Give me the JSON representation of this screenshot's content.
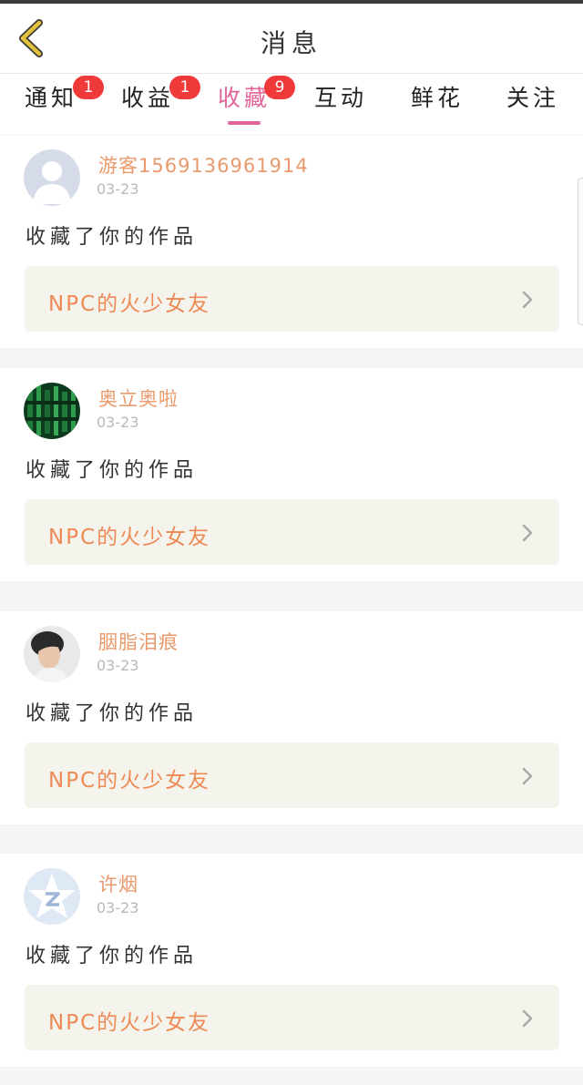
{
  "header": {
    "title": "消息",
    "back_icon": "chevron-left-icon",
    "back_color": "#e2c13b"
  },
  "tabs": [
    {
      "label": "通知",
      "badge": "1",
      "active": false
    },
    {
      "label": "收益",
      "badge": "1",
      "active": false
    },
    {
      "label": "收藏",
      "badge": "9",
      "active": true
    },
    {
      "label": "互动",
      "badge": null,
      "active": false
    },
    {
      "label": "鲜花",
      "badge": null,
      "active": false
    },
    {
      "label": "关注",
      "badge": null,
      "active": false
    }
  ],
  "messages": [
    {
      "username": "游客1569136961914",
      "date": "03-23",
      "text": "收藏了你的作品",
      "work_title": "NPC的火少女友",
      "avatar": "default-user-avatar"
    },
    {
      "username": "奥立奥啦",
      "date": "03-23",
      "text": "收藏了你的作品",
      "work_title": "NPC的火少女友",
      "avatar": "green-pattern-avatar"
    },
    {
      "username": "胭脂泪痕",
      "date": "03-23",
      "text": "收藏了你的作品",
      "work_title": "NPC的火少女友",
      "avatar": "portrait-avatar"
    },
    {
      "username": "许烟",
      "date": "03-23",
      "text": "收藏了你的作品",
      "work_title": "NPC的火少女友",
      "avatar": "qzone-star-avatar"
    }
  ],
  "colors": {
    "accent_pink": "#e0649a",
    "badge_red": "#f03a3a",
    "username_orange": "#e99a6c",
    "work_title_orange": "#ee8a55",
    "work_link_bg": "#f4f3ec"
  }
}
